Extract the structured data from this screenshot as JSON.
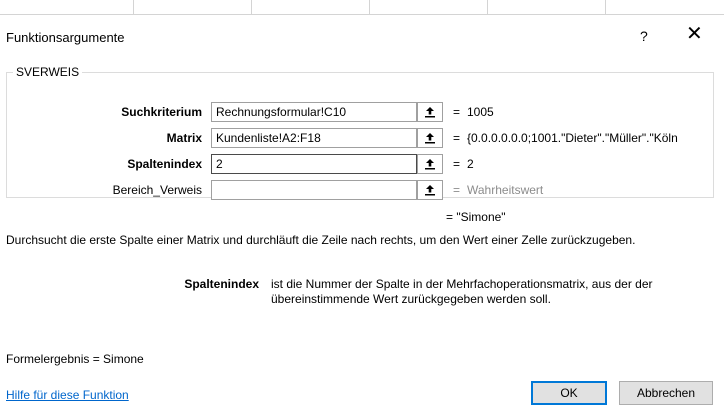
{
  "dialog": {
    "title": "Funktionsargumente",
    "help_button": "?",
    "close_button": "✕"
  },
  "function_group": {
    "name": "SVERWEIS",
    "arguments": [
      {
        "label": "Suchkriterium",
        "bold": true,
        "value": "Rechnungsformular!C10",
        "result": "1005"
      },
      {
        "label": "Matrix",
        "bold": true,
        "value": "Kundenliste!A2:F18",
        "result": "{0.0.0.0.0.0;1001.\"Dieter\".\"Müller\".\"Köln"
      },
      {
        "label": "Spaltenindex",
        "bold": true,
        "value": "2",
        "result": "2"
      },
      {
        "label": "Bereich_Verweis",
        "bold": false,
        "value": "",
        "result": "Wahrheitswert"
      }
    ],
    "ref_icon": "collapse-dialog-arrow-icon",
    "equals": "="
  },
  "overall_result": "= \"Simone\"",
  "description": "Durchsucht die erste Spalte einer Matrix und durchläuft die Zeile nach rechts, um den Wert einer Zelle zurückzugeben.",
  "parameter_help": {
    "name": "Spaltenindex",
    "text": "ist die Nummer der Spalte in der Mehrfachoperationsmatrix, aus der der übereinstimmende Wert  zurückgegeben werden soll."
  },
  "formula_result": "Formelergebnis =   Simone",
  "help_link": "Hilfe für diese Funktion",
  "buttons": {
    "ok": "OK",
    "cancel": "Abbrechen"
  },
  "colors": {
    "link": "#0066cc",
    "muted": "#8c8c8c",
    "ok_border": "#0078d7"
  }
}
